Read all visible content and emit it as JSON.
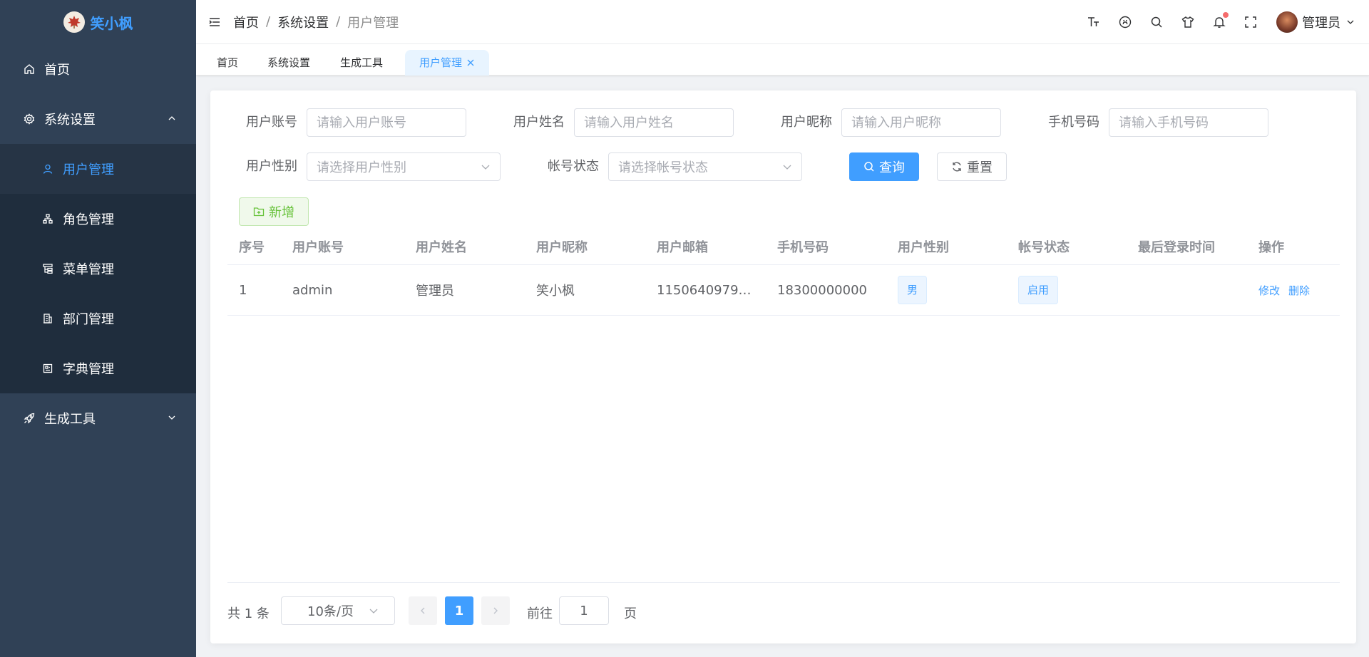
{
  "app": {
    "name": "笑小枫",
    "logo_icon": "maple-leaf-icon"
  },
  "sidebar": {
    "items": [
      {
        "label": "首页",
        "icon": "home-icon"
      },
      {
        "label": "系统设置",
        "icon": "gear-icon",
        "expanded": true,
        "children": [
          {
            "label": "用户管理",
            "icon": "user-icon",
            "active": true
          },
          {
            "label": "角色管理",
            "icon": "org-icon"
          },
          {
            "label": "菜单管理",
            "icon": "tree-table-icon"
          },
          {
            "label": "部门管理",
            "icon": "building-icon"
          },
          {
            "label": "字典管理",
            "icon": "dict-icon"
          }
        ]
      },
      {
        "label": "生成工具",
        "icon": "rocket-icon",
        "expanded": false
      }
    ]
  },
  "header": {
    "breadcrumb": [
      "首页",
      "系统设置",
      "用户管理"
    ],
    "separator": "/",
    "user_name": "管理员",
    "icons": [
      "font-size-icon",
      "github-icon",
      "search-icon",
      "theme-shirt-icon",
      "bell-icon",
      "fullscreen-icon"
    ]
  },
  "tags": [
    "首页",
    "系统设置",
    "生成工具",
    "用户管理"
  ],
  "search_form": {
    "fields": [
      {
        "label": "用户账号",
        "placeholder": "请输入用户账号"
      },
      {
        "label": "用户姓名",
        "placeholder": "请输入用户姓名"
      },
      {
        "label": "用户昵称",
        "placeholder": "请输入用户昵称"
      },
      {
        "label": "手机号码",
        "placeholder": "请输入手机号码"
      },
      {
        "label": "用户性别",
        "placeholder": "请选择用户性别"
      },
      {
        "label": "帐号状态",
        "placeholder": "请选择帐号状态"
      }
    ],
    "search_label": "查询",
    "reset_label": "重置"
  },
  "toolbar": {
    "add_label": "新增"
  },
  "table": {
    "columns": [
      "序号",
      "用户账号",
      "用户姓名",
      "用户昵称",
      "用户邮箱",
      "手机号码",
      "用户性别",
      "帐号状态",
      "最后登录时间",
      "操作"
    ],
    "rows": [
      {
        "index": "1",
        "account": "admin",
        "name": "管理员",
        "nickname": "笑小枫",
        "email": "1150640979…",
        "phone": "18300000000",
        "gender": "男",
        "status": "启用",
        "last_login": "",
        "edit": "修改",
        "delete": "删除"
      }
    ]
  },
  "pagination": {
    "total_text": "共 1 条",
    "page_size": "10条/页",
    "current_page": "1",
    "goto_label": "前往",
    "goto_value": "1",
    "page_suffix": "页"
  },
  "colors": {
    "primary": "#409eff",
    "sidebar_bg": "#304156",
    "success": "#67c23a"
  }
}
